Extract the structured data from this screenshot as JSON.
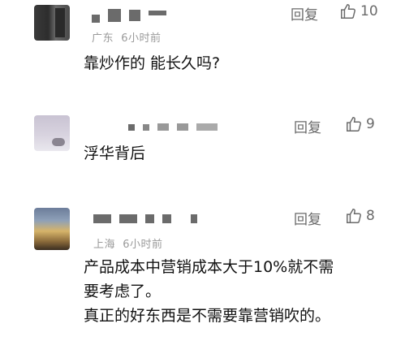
{
  "comments": [
    {
      "location": "广东",
      "time": "6小时前",
      "reply_label": "回复",
      "likes": "10",
      "text_lines": [
        "靠炒作的 能长久吗?"
      ]
    },
    {
      "location": "",
      "time": "",
      "reply_label": "回复",
      "likes": "9",
      "text_lines": [
        "浮华背后"
      ]
    },
    {
      "location": "上海",
      "time": "6小时前",
      "reply_label": "回复",
      "likes": "8",
      "text_lines": [
        "产品成本中营销成本大于10%就不需",
        "要考虑了。",
        "真正的好东西是不需要靠营销吹的。"
      ]
    }
  ],
  "icons": {
    "like": "thumbs-up-icon"
  }
}
